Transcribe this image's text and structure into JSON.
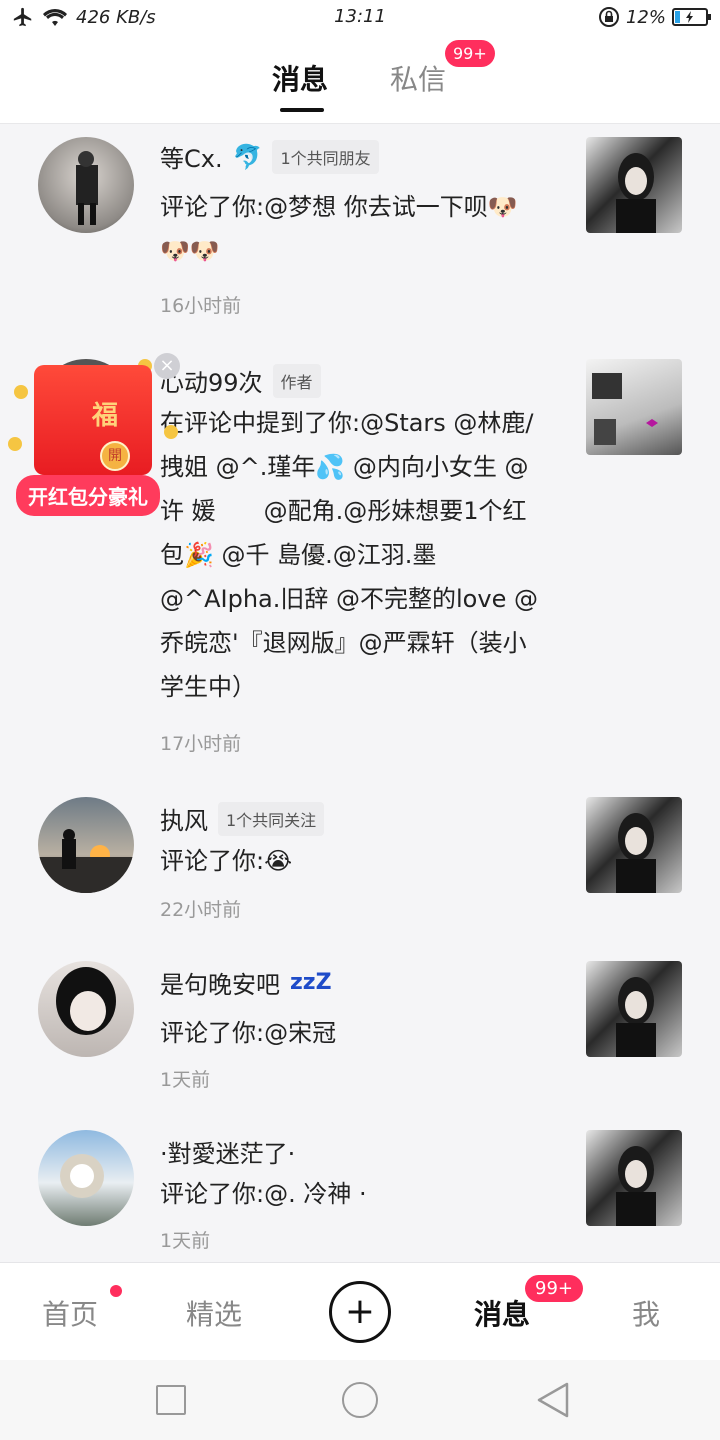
{
  "status": {
    "speed": "426 KB/s",
    "time": "13:11",
    "battery": "12%",
    "icons": [
      "airplane-icon",
      "wifi-icon",
      "rotation-lock-icon",
      "battery-icon"
    ]
  },
  "header": {
    "tab_messages": "消息",
    "tab_dm": "私信",
    "dm_badge": "99+"
  },
  "feed": [
    {
      "name": "等Cx.",
      "name_emoji": "🐬",
      "tag": "1个共同朋友",
      "comment": "评论了你:@梦想 你去试一下呗🐶🐶🐶",
      "time": "16小时前"
    },
    {
      "name": "心动99次",
      "tag": "作者",
      "comment": "在评论中提到了你:@Stars @林鹿/拽姐 @^.瑾年💦 @内向小女生 @许 媛　　@配角.@彤妹想要1个红包🎉 @千 島優.@江羽.墨 @^AIpha.旧辞 @不完整的love @乔皖恋'『退网版』@严霖轩（装小学生中）",
      "time": "17小时前"
    },
    {
      "name": "执风",
      "tag": "1个共同关注",
      "comment": "评论了你:😭",
      "time": "22小时前"
    },
    {
      "name": "是句晚安吧",
      "name_emoji": "zzZ",
      "comment": "评论了你:@宋冠",
      "time": "1天前"
    },
    {
      "name": "·對愛迷茫了·",
      "comment": "评论了你:@. 冷神 ·",
      "time": "1天前"
    }
  ],
  "redpacket": {
    "fu": "福",
    "seal": "開",
    "label": "开红包分豪礼",
    "close": "×"
  },
  "nav": {
    "home": "首页",
    "featured": "精选",
    "add": "+",
    "messages": "消息",
    "messages_badge": "99+",
    "me": "我"
  },
  "colors": {
    "accent": "#ff2e5d",
    "background": "#f5f5f7",
    "text": "#222222",
    "muted": "#999999"
  }
}
